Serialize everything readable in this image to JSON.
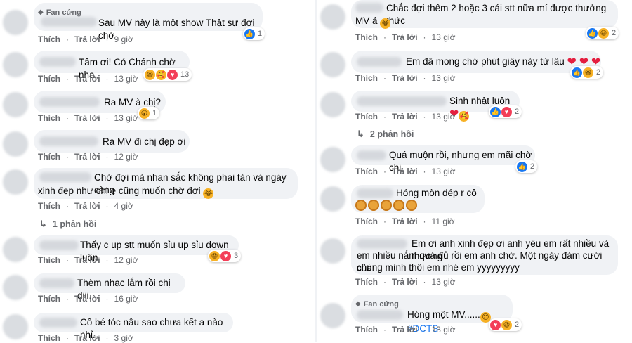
{
  "fan_badge": "Fan cứng",
  "actions": {
    "like": "Thích",
    "reply": "Trả lời"
  },
  "left": {
    "c1": {
      "text": "Sau MV này là một show Thật sự đợi chờ",
      "time": "9 giờ",
      "react": "1"
    },
    "c2": {
      "text": "Tâm ơi! Có Chánh chờ nha.",
      "time": "13 giờ",
      "react": "13"
    },
    "c3": {
      "text": "Ra MV à chị?",
      "time": "13 giờ",
      "react": "1"
    },
    "c4": {
      "text": "Ra MV đi chị đẹp ơi",
      "time": "12 giờ"
    },
    "c5": {
      "line1": "Chờ đợi mà nhan sắc không phai tàn và ngày càng",
      "line2": "xinh đẹp như chị e cũng muốn chờ đợi",
      "time": "4 giờ"
    },
    "replies": "1 phản hồi",
    "c6": {
      "text": "Thấy c up stt muốn sỉu up sỉu down luôn",
      "time": "12 giờ",
      "react": "3"
    },
    "c7": {
      "text": "Thèm nhạc lắm rồi chị diii.",
      "time": "16 giờ"
    },
    "c8": {
      "text": "Cô bé tóc nâu sao chưa kết a nào nhỉ.",
      "time": "3 giờ"
    }
  },
  "right": {
    "r1": {
      "line1": "Chắc đợi thêm 2 hoặc 3 cái stt nữa mí được thưởng thức",
      "line2": "MV á",
      "time": "13 giờ",
      "react": "2"
    },
    "r2": {
      "text": "Em đã mong chờ phút giây này từ lâu",
      "time": "13 giờ",
      "react": "2"
    },
    "r3": {
      "text": "Sinh nhật luôn",
      "time": "13 giờ",
      "react": "2"
    },
    "replies": "2 phản hồi",
    "r4": {
      "text": "Quá muộn rồi, nhưng em mãi chờ chị",
      "time": "13 giờ",
      "react": "2"
    },
    "r5": {
      "text": "Hóng mòn dép r cô ơi",
      "time": "11 giờ"
    },
    "r6": {
      "line1": "Em ơi anh xinh đẹp ơi anh yêu em rất nhiều và thương",
      "line2": "em nhiều nắm quá đủ rồi em anh chờ. Một ngày đám cưới của",
      "line3": "chúng mình thôi em nhé em yyyyyyyyy",
      "time": "13 giờ"
    },
    "r7": {
      "text": "Hóng một MV......",
      "hashtag": "#DCTS",
      "time": "13 giờ",
      "react": "2"
    }
  }
}
